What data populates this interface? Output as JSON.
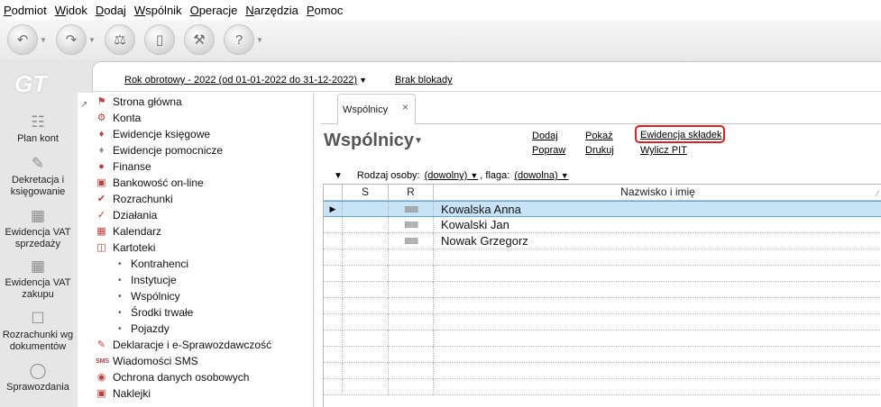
{
  "menu": [
    "Podmiot",
    "Widok",
    "Dodaj",
    "Wspólnik",
    "Operacje",
    "Narzędzia",
    "Pomoc"
  ],
  "toolbar": {
    "buttons": [
      "back-icon",
      "forward-icon",
      "stamp-icon",
      "eraser-icon",
      "tools-icon",
      "help-icon"
    ]
  },
  "logo": "GT",
  "shortcuts": [
    {
      "label": "Plan kont",
      "icon": "chart-of-accounts-icon"
    },
    {
      "label": "Dekretacja i księgowanie",
      "icon": "posting-icon"
    },
    {
      "label": "Ewidencja VAT sprzedaży",
      "icon": "vat-sales-icon"
    },
    {
      "label": "Ewidencja VAT zakupu",
      "icon": "vat-purchase-icon"
    },
    {
      "label": "Rozrachunki wg dokumentów",
      "icon": "settlements-icon"
    },
    {
      "label": "Sprawozdania",
      "icon": "reports-icon"
    }
  ],
  "header": {
    "year": "Rok obrotowy - 2022  (od 01-01-2022 do 31-12-2022)",
    "lock": "Brak blokady"
  },
  "tree": {
    "items": [
      {
        "label": "Strona główna",
        "icon": "home-icon"
      },
      {
        "label": "Konta",
        "icon": "accounts-icon"
      },
      {
        "label": "Ewidencje księgowe",
        "icon": "ledger-icon"
      },
      {
        "label": "Ewidencje pomocnicze",
        "icon": "aux-ledger-icon"
      },
      {
        "label": "Finanse",
        "icon": "finance-icon"
      },
      {
        "label": "Bankowość on-line",
        "icon": "bank-icon"
      },
      {
        "label": "Rozrachunki",
        "icon": "settlement-icon"
      },
      {
        "label": "Działania",
        "icon": "actions-icon"
      },
      {
        "label": "Kalendarz",
        "icon": "calendar-icon"
      },
      {
        "label": "Kartoteki",
        "icon": "cards-icon"
      }
    ],
    "subitems": [
      "Kontrahenci",
      "Instytucje",
      "Wspólnicy",
      "Środki trwałe",
      "Pojazdy"
    ],
    "items_after": [
      {
        "label": "Deklaracje i e-Sprawozdawczość",
        "icon": "declaration-icon"
      },
      {
        "label": "Wiadomości SMS",
        "icon": "sms-icon"
      },
      {
        "label": "Ochrona danych osobowych",
        "icon": "shield-icon"
      },
      {
        "label": "Naklejki",
        "icon": "sticker-icon"
      }
    ]
  },
  "tab": {
    "label": "Wspólnicy",
    "close": "×"
  },
  "page": {
    "title": "Wspólnicy",
    "actions": {
      "dodaj": "Dodaj",
      "popraw": "Popraw",
      "pokaz": "Pokaż",
      "drukuj": "Drukuj",
      "ewidencja": "Ewidencja składek",
      "wylicz": "Wylicz PIT"
    }
  },
  "filter": {
    "label1": "Rodzaj osoby:",
    "value1": "(dowolny)",
    "label2": ", flaga:",
    "value2": "(dowolna)"
  },
  "grid": {
    "columns": [
      "S",
      "R",
      "Nazwisko i imię"
    ],
    "rows": [
      {
        "name": "Kowalska Anna",
        "selected": true
      },
      {
        "name": "Kowalski Jan",
        "selected": false
      },
      {
        "name": "Nowak Grzegorz",
        "selected": false
      }
    ],
    "empty_rows": 9
  },
  "colors": {
    "highlight": "#e0201e",
    "selection": "#c9e3f6"
  }
}
